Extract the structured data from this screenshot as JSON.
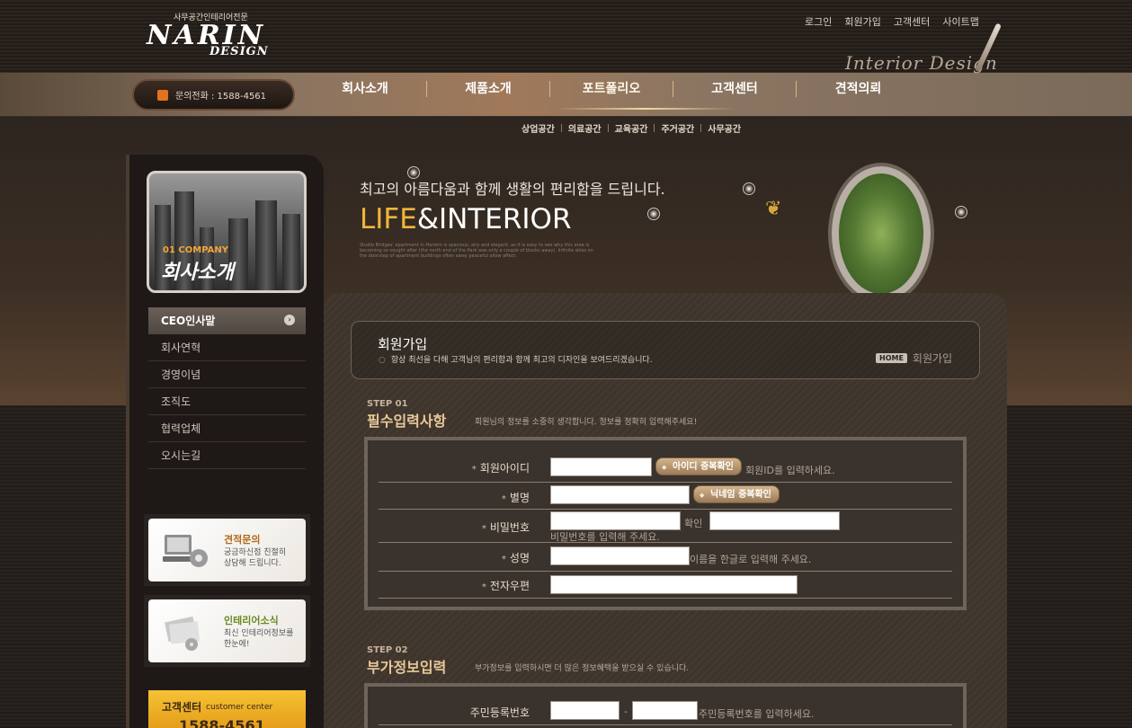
{
  "logo": {
    "sub": "사무공간인테리어전문",
    "main": "NARIN",
    "design": "DESIGN"
  },
  "top_links": [
    "로그인",
    "회원가입",
    "고객센터",
    "사이트맵"
  ],
  "interior_script": "Interior Design",
  "phone": {
    "label": "문의전화 : 1588-4561"
  },
  "gnb": [
    "회사소개",
    "제품소개",
    "포트폴리오",
    "고객센터",
    "견적의뢰"
  ],
  "subnav": [
    "상업공간",
    "의료공간",
    "교육공간",
    "주거공간",
    "사무공간"
  ],
  "sidebar": {
    "photo_en": "01 COMPANY",
    "photo_ko": "회사소개",
    "menu": [
      "CEO인사말",
      "회사연혁",
      "경영이념",
      "조직도",
      "협력업체",
      "오시는길"
    ],
    "banner1": {
      "title": "견적문의",
      "desc": "궁금하신점 친절히 상담해 드립니다."
    },
    "banner2": {
      "title": "인테리어소식",
      "desc": "최신 인테리어정보를 한눈에!"
    },
    "banner3": {
      "title": "고객센터",
      "en": "customer center",
      "num": "1588-4561"
    }
  },
  "visual": {
    "copy": "최고의 아름다움과 함께 생활의 편리함을 드립니다.",
    "title_gold": "LIFE",
    "title_white": "&INTERIOR",
    "small": "Studio Bridges' apartment in Harlem is spacious, airy and elegant, as it is easy to see why this area is becoming so sought after (the north end of the Park was only a couple of blocks away). Infinite skies on the doorstep of apartment buildings often away peaceful allow affect."
  },
  "title_box": {
    "title": "회원가입",
    "desc": "항상 최선을 다해 고객님의 편리함과 함께 최고의 디자인을 보여드리겠습니다.",
    "crumb_home": "HOME",
    "crumb_current": "회원가입"
  },
  "step1": {
    "num": "STEP 01",
    "head": "필수입력사항",
    "desc": "회원님의 정보를 소중히 생각합니다. 정보를 정확히 입력해주세요!",
    "rows": {
      "id_label": "회원아이디",
      "id_button": "아이디 중복확인",
      "id_hint": "회원ID를 입력하세요.",
      "nick_label": "별명",
      "nick_button": "닉네임 중복확인",
      "pw_label": "비밀번호",
      "pw_confirm": "확인",
      "pw_hint": "비밀번호를 입력해 주세요.",
      "name_label": "성명",
      "name_hint": "이름을 한글로 입력해 주세요.",
      "email_label": "전자우편",
      "required_mark": "*"
    }
  },
  "step2": {
    "num": "STEP 02",
    "head": "부가정보입력",
    "desc": "부가정보를 입력하시면 더 많은 정보혜택을 받으실 수 있습니다.",
    "rows": {
      "rrn_label": "주민등록번호",
      "rrn_dash": "-",
      "rrn_hint": "주민등록번호를 입력하세요."
    }
  }
}
